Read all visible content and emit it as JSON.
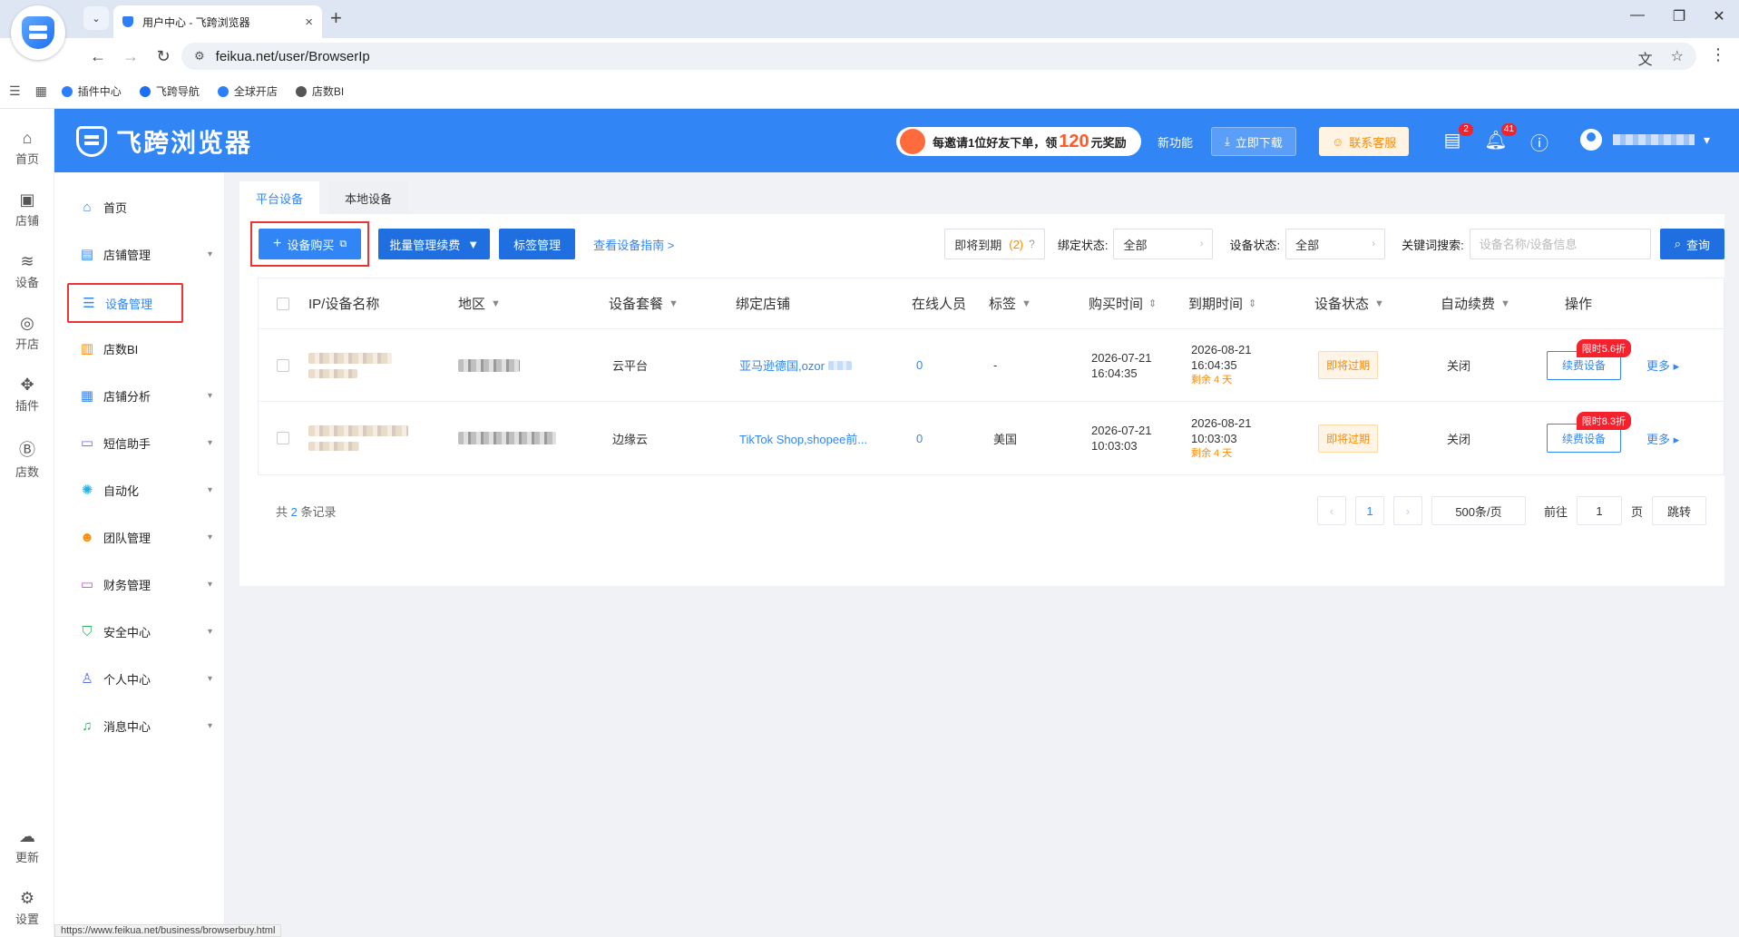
{
  "browser": {
    "tab_title": "用户中心 - 飞跨浏览器",
    "url": "feikua.net/user/BrowserIp",
    "bookmarks": [
      "插件中心",
      "飞跨导航",
      "全球开店",
      "店数BI"
    ],
    "status_url": "https://www.feikua.net/business/browserbuy.html"
  },
  "header": {
    "logo_text": "飞跨浏览器",
    "promo_prefix": "每邀请1位好友下单，领",
    "promo_amount": "120",
    "promo_suffix": "元奖励",
    "new_feature": "新功能",
    "download_label": "立即下载",
    "support_label": "联系客服",
    "message_badge": "2",
    "notification_badge": "41"
  },
  "rail": [
    {
      "label": "首页",
      "icon": "home-icon"
    },
    {
      "label": "店铺",
      "icon": "store-icon"
    },
    {
      "label": "设备",
      "icon": "layers-icon"
    },
    {
      "label": "开店",
      "icon": "planet-icon"
    },
    {
      "label": "插件",
      "icon": "puzzle-icon"
    },
    {
      "label": "店数",
      "icon": "bi-icon"
    },
    {
      "label": "更新",
      "icon": "cloud-icon"
    },
    {
      "label": "设置",
      "icon": "gear-icon"
    }
  ],
  "sidebar": {
    "items": [
      {
        "label": "首页",
        "icon": "home-icon"
      },
      {
        "label": "店铺管理",
        "icon": "shop-icon"
      },
      {
        "label": "设备管理",
        "icon": "server-icon"
      },
      {
        "label": "店数BI",
        "icon": "bar-chart-icon"
      },
      {
        "label": "店铺分析",
        "icon": "grid-icon"
      },
      {
        "label": "短信助手",
        "icon": "message-icon"
      },
      {
        "label": "自动化",
        "icon": "automation-icon"
      },
      {
        "label": "团队管理",
        "icon": "team-icon"
      },
      {
        "label": "财务管理",
        "icon": "wallet-icon"
      },
      {
        "label": "安全中心",
        "icon": "shield-check-icon"
      },
      {
        "label": "个人中心",
        "icon": "user-icon"
      },
      {
        "label": "消息中心",
        "icon": "bell-icon"
      }
    ]
  },
  "content": {
    "tabs": [
      "平台设备",
      "本地设备"
    ],
    "buy_label": "设备购买",
    "batch_label": "批量管理续费",
    "tag_label": "标签管理",
    "guide_label": "查看设备指南 >",
    "expiring_label": "即将到期",
    "expiring_count": "(2)",
    "bind_status_label": "绑定状态:",
    "bind_status_value": "全部",
    "device_status_label": "设备状态:",
    "device_status_value": "全部",
    "keyword_label": "关键词搜索:",
    "keyword_placeholder": "设备名称/设备信息",
    "query_label": "查询"
  },
  "table": {
    "columns": [
      "IP/设备名称",
      "地区",
      "设备套餐",
      "绑定店铺",
      "在线人员",
      "标签",
      "购买时间",
      "到期时间",
      "设备状态",
      "自动续费",
      "操作"
    ],
    "rows": [
      {
        "plan": "云平台",
        "store": "亚马逊德国,ozor",
        "online": "0",
        "tag": "-",
        "buy_date": "2026-07-21",
        "buy_time": "16:04:35",
        "expire_date": "2026-08-21",
        "expire_time": "16:04:35",
        "remain": "剩余 4 天",
        "status": "即将过期",
        "auto_renew": "关闭",
        "renew_label": "续费设备",
        "discount": "限时5.6折",
        "more": "更多"
      },
      {
        "plan": "边缘云",
        "store": "TikTok Shop,shopee前...",
        "online": "0",
        "tag": "美国",
        "buy_date": "2026-07-21",
        "buy_time": "10:03:03",
        "expire_date": "2026-08-21",
        "expire_time": "10:03:03",
        "remain": "剩余 4 天",
        "status": "即将过期",
        "auto_renew": "关闭",
        "renew_label": "续费设备",
        "discount": "限时8.3折",
        "more": "更多"
      }
    ]
  },
  "pagination": {
    "total_prefix": "共",
    "total_count": "2",
    "total_suffix": "条记录",
    "current_page": "1",
    "page_size": "500条/页",
    "goto_label": "前往",
    "goto_value": "1",
    "page_unit": "页",
    "jump_label": "跳转"
  },
  "colors": {
    "brand_blue": "#3185f5",
    "warning_orange": "#ff8a00",
    "highlight_red": "#e33"
  }
}
